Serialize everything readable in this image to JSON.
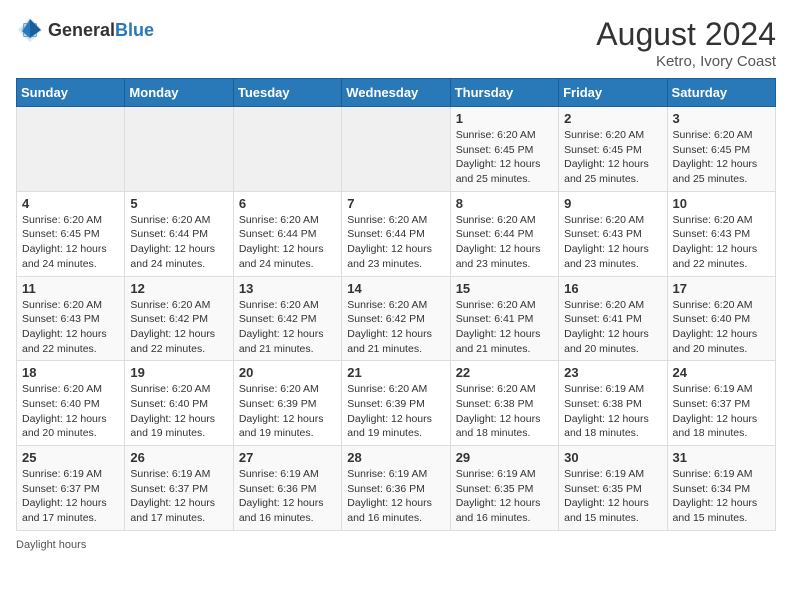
{
  "header": {
    "logo_general": "General",
    "logo_blue": "Blue",
    "month_year": "August 2024",
    "location": "Ketro, Ivory Coast"
  },
  "footer": {
    "daylight_label": "Daylight hours"
  },
  "weekdays": [
    "Sunday",
    "Monday",
    "Tuesday",
    "Wednesday",
    "Thursday",
    "Friday",
    "Saturday"
  ],
  "weeks": [
    [
      {
        "day": "",
        "sunrise": "",
        "sunset": "",
        "daylight": ""
      },
      {
        "day": "",
        "sunrise": "",
        "sunset": "",
        "daylight": ""
      },
      {
        "day": "",
        "sunrise": "",
        "sunset": "",
        "daylight": ""
      },
      {
        "day": "",
        "sunrise": "",
        "sunset": "",
        "daylight": ""
      },
      {
        "day": "1",
        "sunrise": "Sunrise: 6:20 AM",
        "sunset": "Sunset: 6:45 PM",
        "daylight": "Daylight: 12 hours and 25 minutes."
      },
      {
        "day": "2",
        "sunrise": "Sunrise: 6:20 AM",
        "sunset": "Sunset: 6:45 PM",
        "daylight": "Daylight: 12 hours and 25 minutes."
      },
      {
        "day": "3",
        "sunrise": "Sunrise: 6:20 AM",
        "sunset": "Sunset: 6:45 PM",
        "daylight": "Daylight: 12 hours and 25 minutes."
      }
    ],
    [
      {
        "day": "4",
        "sunrise": "Sunrise: 6:20 AM",
        "sunset": "Sunset: 6:45 PM",
        "daylight": "Daylight: 12 hours and 24 minutes."
      },
      {
        "day": "5",
        "sunrise": "Sunrise: 6:20 AM",
        "sunset": "Sunset: 6:44 PM",
        "daylight": "Daylight: 12 hours and 24 minutes."
      },
      {
        "day": "6",
        "sunrise": "Sunrise: 6:20 AM",
        "sunset": "Sunset: 6:44 PM",
        "daylight": "Daylight: 12 hours and 24 minutes."
      },
      {
        "day": "7",
        "sunrise": "Sunrise: 6:20 AM",
        "sunset": "Sunset: 6:44 PM",
        "daylight": "Daylight: 12 hours and 23 minutes."
      },
      {
        "day": "8",
        "sunrise": "Sunrise: 6:20 AM",
        "sunset": "Sunset: 6:44 PM",
        "daylight": "Daylight: 12 hours and 23 minutes."
      },
      {
        "day": "9",
        "sunrise": "Sunrise: 6:20 AM",
        "sunset": "Sunset: 6:43 PM",
        "daylight": "Daylight: 12 hours and 23 minutes."
      },
      {
        "day": "10",
        "sunrise": "Sunrise: 6:20 AM",
        "sunset": "Sunset: 6:43 PM",
        "daylight": "Daylight: 12 hours and 22 minutes."
      }
    ],
    [
      {
        "day": "11",
        "sunrise": "Sunrise: 6:20 AM",
        "sunset": "Sunset: 6:43 PM",
        "daylight": "Daylight: 12 hours and 22 minutes."
      },
      {
        "day": "12",
        "sunrise": "Sunrise: 6:20 AM",
        "sunset": "Sunset: 6:42 PM",
        "daylight": "Daylight: 12 hours and 22 minutes."
      },
      {
        "day": "13",
        "sunrise": "Sunrise: 6:20 AM",
        "sunset": "Sunset: 6:42 PM",
        "daylight": "Daylight: 12 hours and 21 minutes."
      },
      {
        "day": "14",
        "sunrise": "Sunrise: 6:20 AM",
        "sunset": "Sunset: 6:42 PM",
        "daylight": "Daylight: 12 hours and 21 minutes."
      },
      {
        "day": "15",
        "sunrise": "Sunrise: 6:20 AM",
        "sunset": "Sunset: 6:41 PM",
        "daylight": "Daylight: 12 hours and 21 minutes."
      },
      {
        "day": "16",
        "sunrise": "Sunrise: 6:20 AM",
        "sunset": "Sunset: 6:41 PM",
        "daylight": "Daylight: 12 hours and 20 minutes."
      },
      {
        "day": "17",
        "sunrise": "Sunrise: 6:20 AM",
        "sunset": "Sunset: 6:40 PM",
        "daylight": "Daylight: 12 hours and 20 minutes."
      }
    ],
    [
      {
        "day": "18",
        "sunrise": "Sunrise: 6:20 AM",
        "sunset": "Sunset: 6:40 PM",
        "daylight": "Daylight: 12 hours and 20 minutes."
      },
      {
        "day": "19",
        "sunrise": "Sunrise: 6:20 AM",
        "sunset": "Sunset: 6:40 PM",
        "daylight": "Daylight: 12 hours and 19 minutes."
      },
      {
        "day": "20",
        "sunrise": "Sunrise: 6:20 AM",
        "sunset": "Sunset: 6:39 PM",
        "daylight": "Daylight: 12 hours and 19 minutes."
      },
      {
        "day": "21",
        "sunrise": "Sunrise: 6:20 AM",
        "sunset": "Sunset: 6:39 PM",
        "daylight": "Daylight: 12 hours and 19 minutes."
      },
      {
        "day": "22",
        "sunrise": "Sunrise: 6:20 AM",
        "sunset": "Sunset: 6:38 PM",
        "daylight": "Daylight: 12 hours and 18 minutes."
      },
      {
        "day": "23",
        "sunrise": "Sunrise: 6:19 AM",
        "sunset": "Sunset: 6:38 PM",
        "daylight": "Daylight: 12 hours and 18 minutes."
      },
      {
        "day": "24",
        "sunrise": "Sunrise: 6:19 AM",
        "sunset": "Sunset: 6:37 PM",
        "daylight": "Daylight: 12 hours and 18 minutes."
      }
    ],
    [
      {
        "day": "25",
        "sunrise": "Sunrise: 6:19 AM",
        "sunset": "Sunset: 6:37 PM",
        "daylight": "Daylight: 12 hours and 17 minutes."
      },
      {
        "day": "26",
        "sunrise": "Sunrise: 6:19 AM",
        "sunset": "Sunset: 6:37 PM",
        "daylight": "Daylight: 12 hours and 17 minutes."
      },
      {
        "day": "27",
        "sunrise": "Sunrise: 6:19 AM",
        "sunset": "Sunset: 6:36 PM",
        "daylight": "Daylight: 12 hours and 16 minutes."
      },
      {
        "day": "28",
        "sunrise": "Sunrise: 6:19 AM",
        "sunset": "Sunset: 6:36 PM",
        "daylight": "Daylight: 12 hours and 16 minutes."
      },
      {
        "day": "29",
        "sunrise": "Sunrise: 6:19 AM",
        "sunset": "Sunset: 6:35 PM",
        "daylight": "Daylight: 12 hours and 16 minutes."
      },
      {
        "day": "30",
        "sunrise": "Sunrise: 6:19 AM",
        "sunset": "Sunset: 6:35 PM",
        "daylight": "Daylight: 12 hours and 15 minutes."
      },
      {
        "day": "31",
        "sunrise": "Sunrise: 6:19 AM",
        "sunset": "Sunset: 6:34 PM",
        "daylight": "Daylight: 12 hours and 15 minutes."
      }
    ]
  ]
}
